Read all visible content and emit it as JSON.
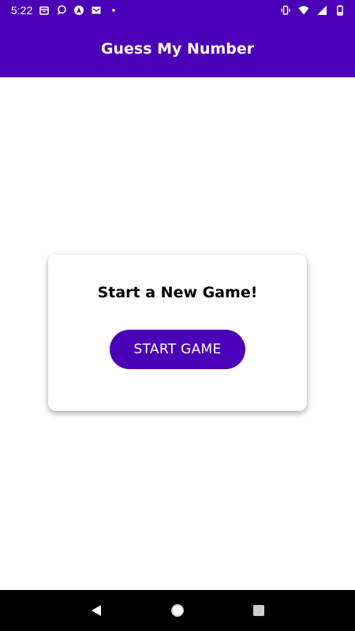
{
  "status_bar": {
    "time": "5:22",
    "left_icons": [
      "calendar-icon",
      "chat-bubble-icon",
      "vpn-icon",
      "mail-icon",
      "dot-icon"
    ],
    "right_icons": [
      "vibrate-icon",
      "wifi-icon",
      "cell-signal-icon",
      "battery-icon"
    ]
  },
  "app_bar": {
    "title": "Guess My Number",
    "color": "#4b00b7"
  },
  "card": {
    "title": "Start a New Game!",
    "button_label": "START GAME",
    "button_color": "#4b00b7"
  },
  "nav_bar": {
    "buttons": [
      "back-icon",
      "home-icon",
      "recents-icon"
    ]
  }
}
